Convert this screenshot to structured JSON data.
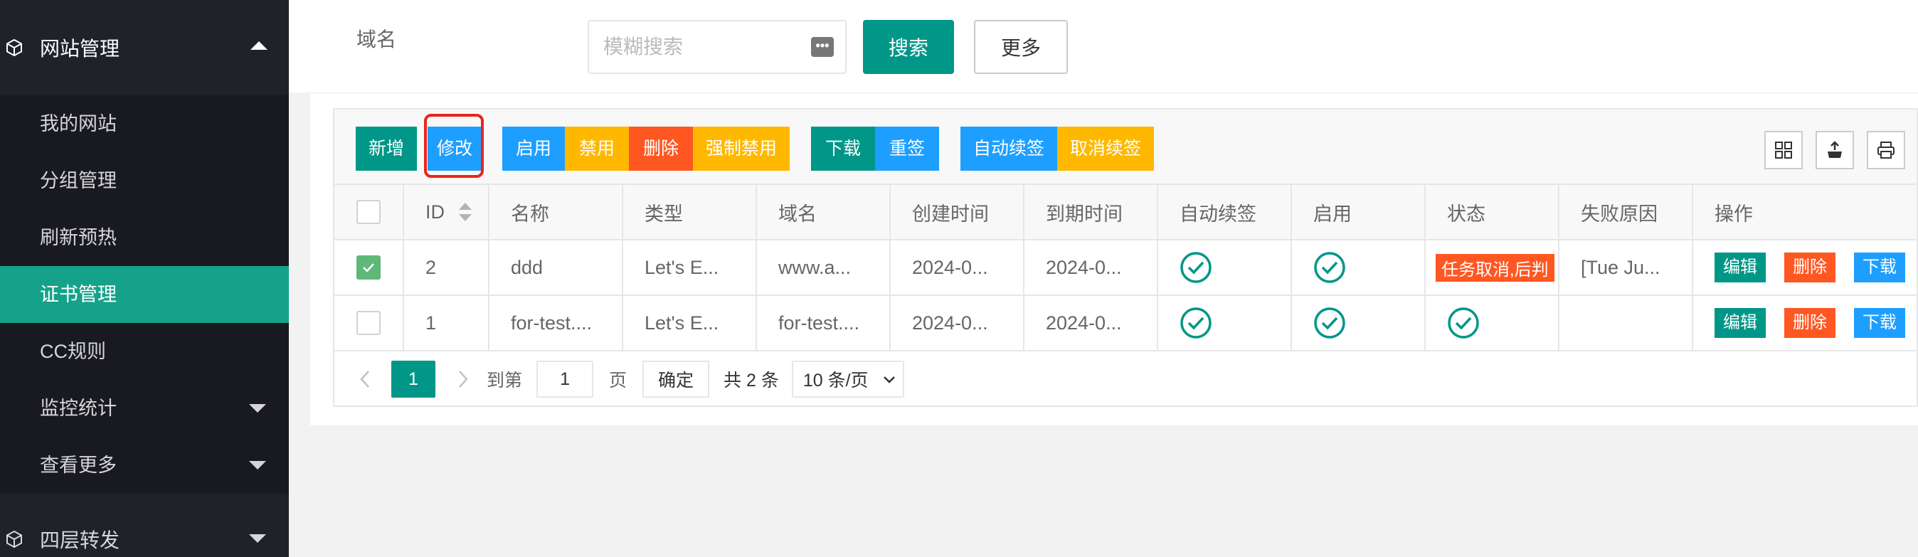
{
  "sidebar": {
    "group_website": "网站管理",
    "items": [
      {
        "label": "我的网站"
      },
      {
        "label": "分组管理"
      },
      {
        "label": "刷新预热"
      },
      {
        "label": "证书管理"
      },
      {
        "label": "CC规则"
      },
      {
        "label": "监控统计"
      },
      {
        "label": "查看更多"
      }
    ],
    "group_l4": "四层转发"
  },
  "search": {
    "label": "域名",
    "placeholder": "模糊搜索",
    "search_button": "搜索",
    "more_button": "更多"
  },
  "toolbar": {
    "add": "新增",
    "edit": "修改",
    "enable": "启用",
    "disable": "禁用",
    "delete": "删除",
    "force_disable": "强制禁用",
    "download": "下载",
    "resign": "重签",
    "auto_renew": "自动续签",
    "cancel_renew": "取消续签"
  },
  "table": {
    "columns": [
      "ID",
      "名称",
      "类型",
      "域名",
      "创建时间",
      "到期时间",
      "自动续签",
      "启用",
      "状态",
      "失败原因",
      "操作"
    ],
    "rows": [
      {
        "checked": true,
        "id": "2",
        "name": "ddd",
        "type": "Let's E...",
        "domain": "www.a...",
        "created": "2024-0...",
        "expires": "2024-0...",
        "status": "任务取消,后判",
        "fail_reason": "[Tue Ju..."
      },
      {
        "checked": false,
        "id": "1",
        "name": "for-test....",
        "type": "Let's E...",
        "domain": "for-test....",
        "created": "2024-0...",
        "expires": "2024-0...",
        "status": "",
        "fail_reason": ""
      }
    ],
    "op_edit": "编辑",
    "op_delete": "删除",
    "op_download": "下载"
  },
  "pager": {
    "current": "1",
    "goto_label": "到第",
    "goto_value": "1",
    "page_label": "页",
    "confirm": "确定",
    "total": "共 2 条",
    "page_size": "10 条/页"
  },
  "colors": {
    "primary": "#009688",
    "blue": "#1e9fff",
    "orange": "#ffb800",
    "red": "#ff5722",
    "sidebar_bg": "#20222a",
    "active": "#16a28a"
  }
}
